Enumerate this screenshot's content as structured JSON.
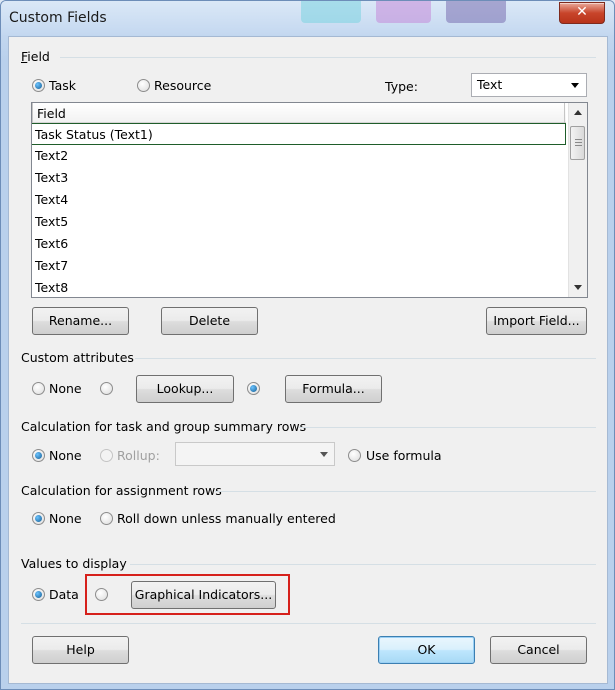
{
  "window": {
    "title": "Custom Fields",
    "close_glyph": "✕"
  },
  "field_group": {
    "label": "Field",
    "task_label": "Task",
    "resource_label": "Resource",
    "type_label": "Type:",
    "type_value": "Text",
    "selected_scope": "Task"
  },
  "field_list": {
    "column_header": "Field",
    "rows": [
      "Task Status (Text1)",
      "Text2",
      "Text3",
      "Text4",
      "Text5",
      "Text6",
      "Text7",
      "Text8"
    ],
    "selected_index": 0
  },
  "list_buttons": {
    "rename": "Rename...",
    "delete": "Delete",
    "import": "Import Field..."
  },
  "custom_attributes": {
    "label": "Custom attributes",
    "none_label": "None",
    "lookup_button": "Lookup...",
    "formula_button": "Formula...",
    "selected": "Formula"
  },
  "summary_calc": {
    "label": "Calculation for task and group summary rows",
    "none_label": "None",
    "rollup_label": "Rollup:",
    "rollup_value": "",
    "use_formula_label": "Use formula",
    "selected": "None"
  },
  "assignment_calc": {
    "label": "Calculation for assignment rows",
    "none_label": "None",
    "rolldown_label": "Roll down unless manually entered",
    "selected": "None"
  },
  "values_display": {
    "label": "Values to display",
    "data_label": "Data",
    "graphical_button": "Graphical Indicators...",
    "selected": "Data",
    "highlight_color": "#d6201b"
  },
  "footer": {
    "help": "Help",
    "ok": "OK",
    "cancel": "Cancel"
  },
  "colors": {
    "dialog_bg": "#f0f0f0",
    "titlebar": "#c4d8f0",
    "close_button": "#c8452b",
    "selection_border": "#1f5d2a",
    "radio_dot": "#145d93"
  }
}
